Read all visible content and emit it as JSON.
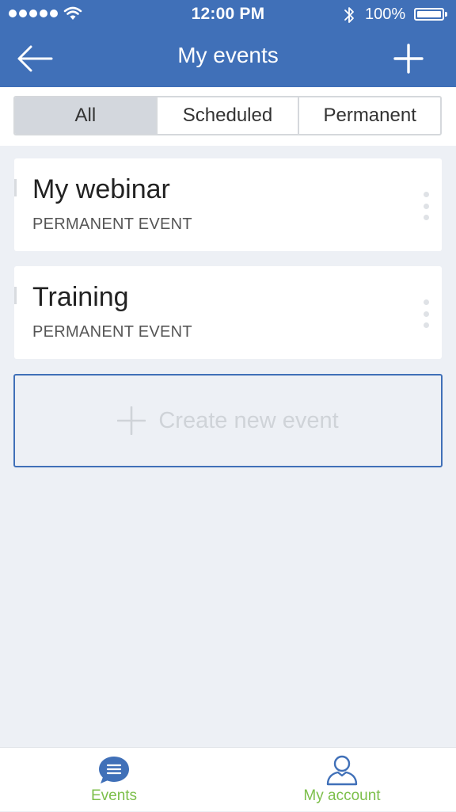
{
  "status_bar": {
    "time": "12:00 PM",
    "battery_percent": "100%",
    "icons": [
      "signal-dots",
      "wifi-icon",
      "bluetooth-icon",
      "battery-icon"
    ]
  },
  "nav": {
    "title": "My events",
    "back_icon": "arrow-left-icon",
    "add_icon": "plus-icon"
  },
  "filter": {
    "segments": [
      "All",
      "Scheduled",
      "Permanent"
    ],
    "selected": "All"
  },
  "events": [
    {
      "title": "My webinar",
      "type": "PERMANENT EVENT"
    },
    {
      "title": "Training",
      "type": "PERMANENT EVENT"
    }
  ],
  "create": {
    "label": "Create new event",
    "icon": "plus-icon"
  },
  "tabbar": {
    "tabs": [
      {
        "label": "Events",
        "icon": "chat-list-icon",
        "active": true
      },
      {
        "label": "My account",
        "icon": "user-icon",
        "active": false
      }
    ]
  },
  "colors": {
    "primary": "#4070b8",
    "accent_green": "#7cbf4a",
    "background": "#edf0f5",
    "segment_selected": "#d3d7dd"
  }
}
